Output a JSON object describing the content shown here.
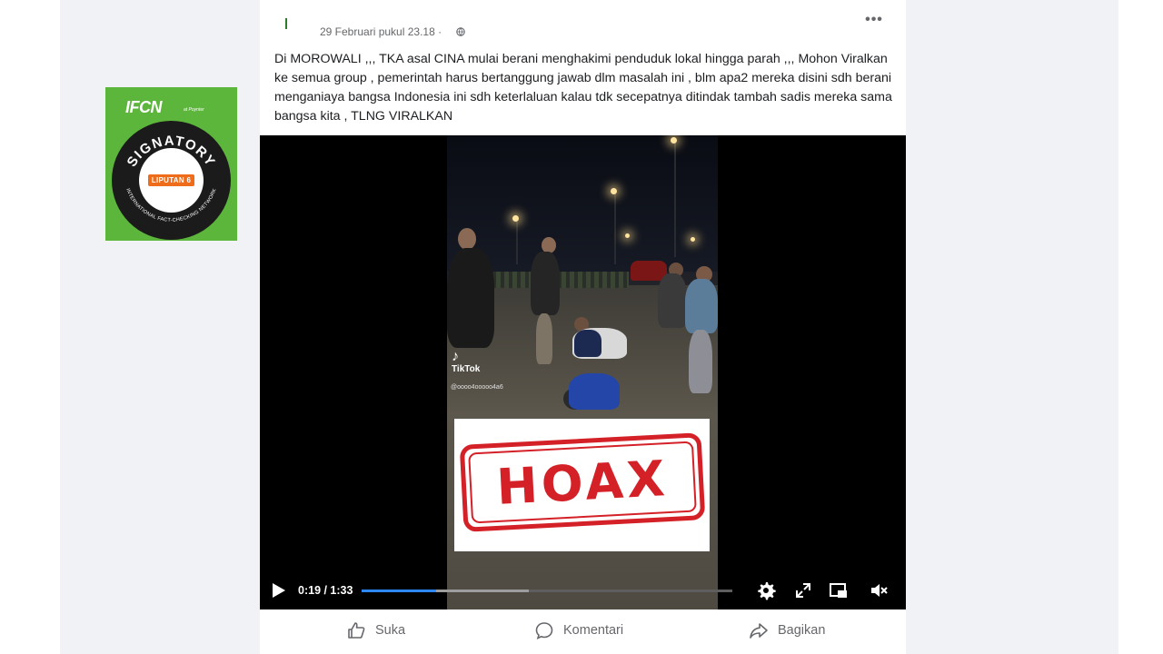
{
  "post": {
    "timestamp": "29 Februari pukul 23.18 ·",
    "more_label": "•••",
    "text": "Di MOROWALI ,,, TKA asal CINA mulai berani menghakimi penduduk lokal hingga parah ,,, Mohon Viralkan ke semua group , pemerintah harus bertanggung jawab dlm masalah ini , blm apa2 mereka disini sdh berani menganiaya bangsa Indonesia ini sdh keterlaluan kalau tdk secepatnya ditindak tambah sadis mereka sama bangsa kita , TLNG VIRALKAN"
  },
  "badge": {
    "logo": "IFCN",
    "sub": "at Poynter",
    "ring_text": "SIGNATORY",
    "ring_bottom": "INTERNATIONAL FACT-CHECKING NETWORK",
    "member": "LIPUTAN 6"
  },
  "video": {
    "watermark": "TikTok",
    "handle": "@oooo4ooooo4a6",
    "stamp": "HOAX",
    "time": "0:19 / 1:33",
    "progress": 0.2,
    "buffered": 0.45
  },
  "actions": {
    "like": "Suka",
    "comment": "Komentari",
    "share": "Bagikan"
  },
  "colors": {
    "accent": "#2d88ff",
    "stamp": "#d42128",
    "ifcn_green": "#5cb63b"
  }
}
